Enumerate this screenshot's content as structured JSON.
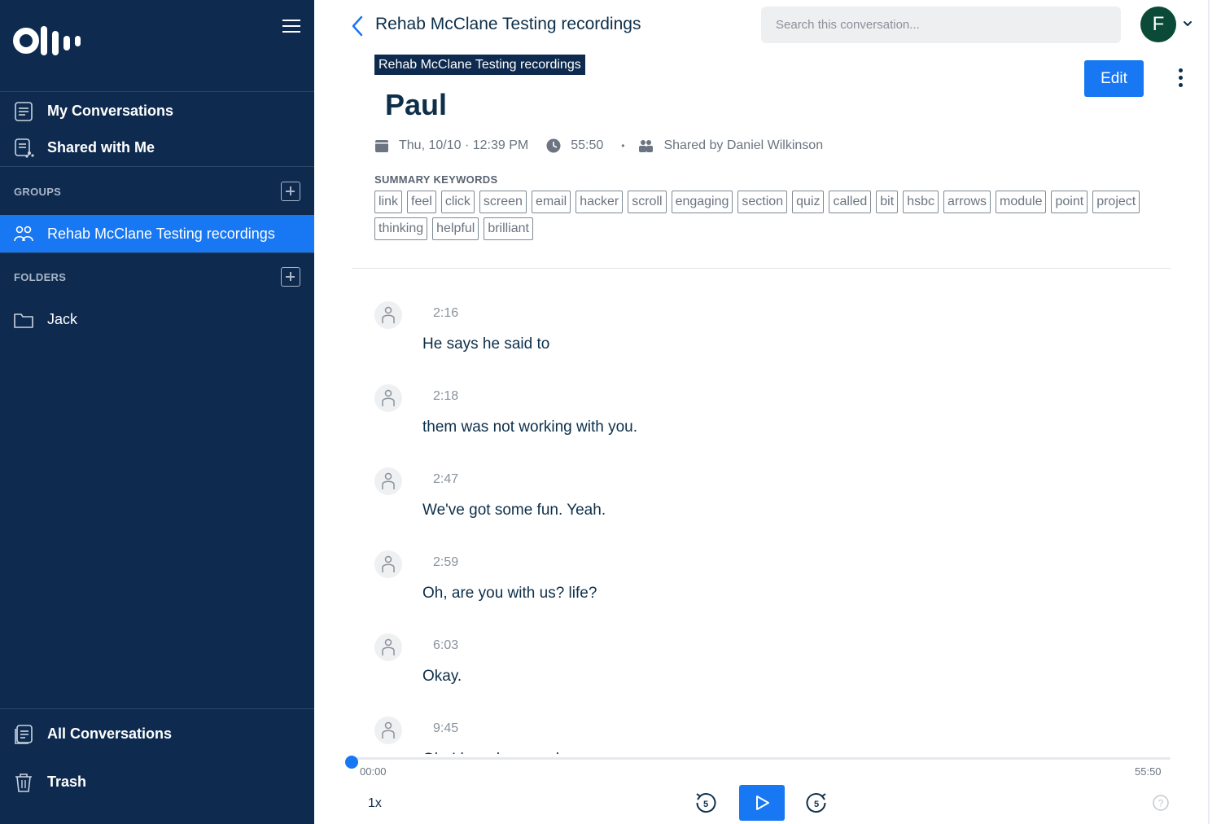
{
  "app": {
    "logo_text": "Otter"
  },
  "sidebar": {
    "nav": [
      {
        "label": "My Conversations",
        "icon": "conversations-icon"
      },
      {
        "label": "Shared with Me",
        "icon": "shared-icon"
      }
    ],
    "groups_heading": "GROUPS",
    "groups": [
      {
        "label": "Rehab McClane Testing recordings",
        "icon": "group-icon",
        "active": true
      }
    ],
    "folders_heading": "FOLDERS",
    "folders": [
      {
        "label": "Jack",
        "icon": "folder-icon"
      }
    ],
    "bottom": [
      {
        "label": "All Conversations",
        "icon": "all-conversations-icon"
      },
      {
        "label": "Trash",
        "icon": "trash-icon"
      }
    ]
  },
  "header": {
    "title": "Rehab McClane Testing recordings",
    "search_placeholder": "Search this conversation...",
    "avatar_initial": "F"
  },
  "conversation": {
    "group_chip": "Rehab McClane Testing recordings",
    "edit_label": "Edit",
    "title": "Paul",
    "date": "Thu, 10/10 · 12:39 PM",
    "duration": "55:50",
    "separator": "•",
    "shared_by": "Shared by Daniel Wilkinson",
    "keywords_heading": "SUMMARY KEYWORDS",
    "keywords": [
      "link",
      "feel",
      "click",
      "screen",
      "email",
      "hacker",
      "scroll",
      "engaging",
      "section",
      "quiz",
      "called",
      "bit",
      "hsbc",
      "arrows",
      "module",
      "point",
      "project",
      "thinking",
      "helpful",
      "brilliant"
    ]
  },
  "transcript": [
    {
      "time": "2:16",
      "text": "He says he said to"
    },
    {
      "time": "2:18",
      "text": "them was not working with you."
    },
    {
      "time": "2:47",
      "text": "We've got some fun. Yeah."
    },
    {
      "time": "2:59",
      "text": "Oh, are you with us? life?"
    },
    {
      "time": "6:03",
      "text": "Okay."
    },
    {
      "time": "9:45",
      "text": "Oh, I heard a sound."
    }
  ],
  "player": {
    "current_time": "00:00",
    "total_time": "55:50",
    "progress": 0,
    "speed": "1x",
    "skip_back_seconds": "5",
    "skip_forward_seconds": "5"
  },
  "colors": {
    "sidebar_bg": "#0e2b4f",
    "accent": "#1877f2",
    "avatar_bg": "#0b4a36",
    "text": "#0d2f4a"
  }
}
